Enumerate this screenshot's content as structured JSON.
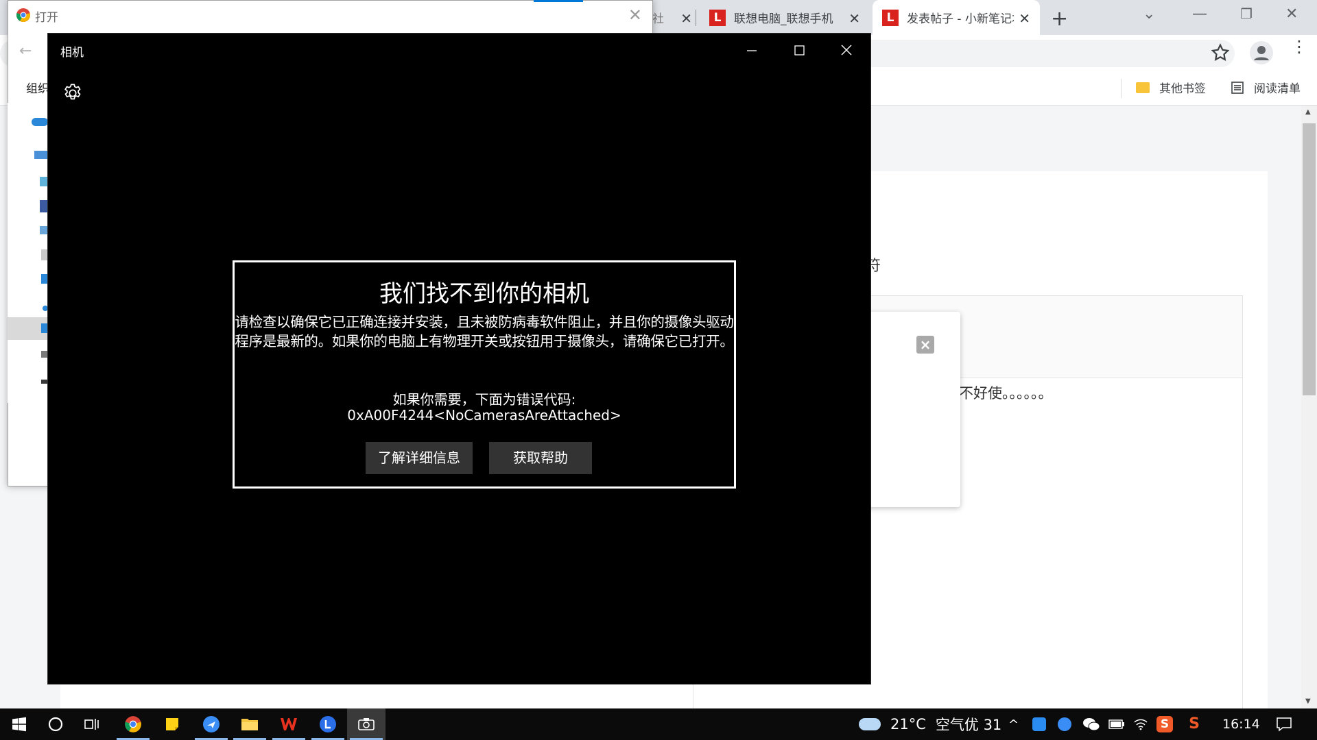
{
  "chrome": {
    "tabs": [
      {
        "title": "社区",
        "visible_fragment": "社"
      },
      {
        "title": "联想电脑_联想手机",
        "favicon": "L"
      },
      {
        "title": "发表帖子 - 小新笔记本",
        "favicon": "L"
      }
    ],
    "bookmarks": [
      {
        "label": "其他书签",
        "icon": "folder-icon"
      },
      {
        "label": "阅读清单",
        "icon": "reading-list-icon"
      }
    ],
    "page": {
      "symbol_text_fragment": "符",
      "reply_text_fragment": "不好使。。。。。。"
    }
  },
  "open_dialog": {
    "title": "打开",
    "organize_label": "组织"
  },
  "camera": {
    "title": "相机",
    "error": {
      "heading": "我们找不到你的相机",
      "body": "请检查以确保它已正确连接并安装，且未被防病毒软件阻止，并且你的摄像头驱动程序是最新的。如果你的电脑上有物理开关或按钮用于摄像头，请确保它已打开。",
      "need_label": "如果你需要，下面为错误代码:",
      "code": "0xA00F4244<NoCamerasAreAttached>",
      "learn_more_button": "了解详细信息",
      "get_help_button": "获取帮助"
    }
  },
  "taskbar": {
    "apps": [
      "start-icon",
      "search-circle-icon",
      "task-view-icon",
      "chrome-icon",
      "sticky-notes-icon",
      "feishu-icon",
      "file-explorer-icon",
      "wps-icon",
      "lenovo-icon",
      "camera-app-icon"
    ],
    "weather": {
      "temperature": "21°C",
      "air_quality": "空气优 31"
    },
    "clock": "16:14"
  },
  "colors": {
    "chrome_accent": "#0078d7",
    "lenovo_red": "#d9231e",
    "camera_bg": "#000000",
    "button_bg": "#333333"
  }
}
